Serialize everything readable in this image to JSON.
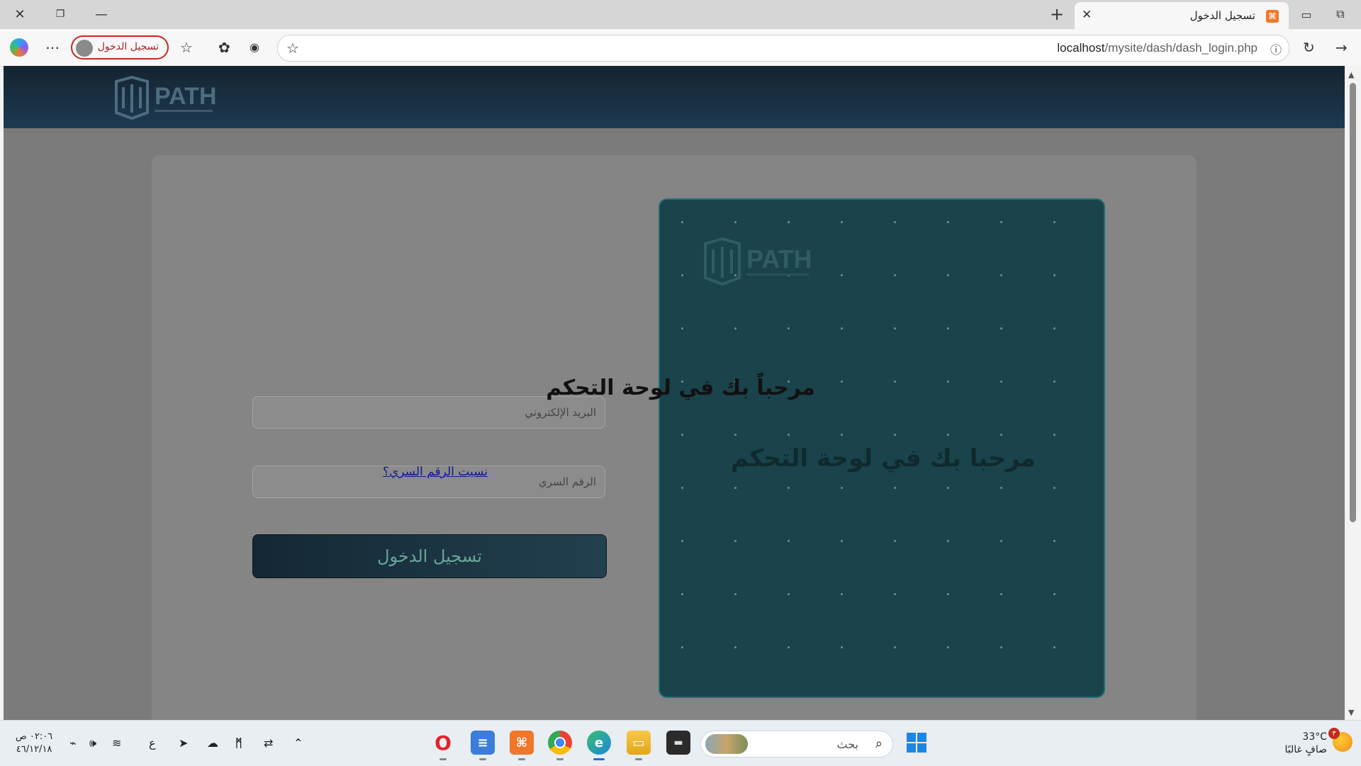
{
  "browser": {
    "tab": {
      "title": "تسجيل الدخول",
      "favicon": "xampp-icon",
      "favicon_color": "#f0762a"
    },
    "url": {
      "host": "localhost",
      "path": "/mysite/dash/dash_login.php"
    },
    "profile": {
      "label": "تسجيل الدخول"
    }
  },
  "page": {
    "logo_text": "PATH",
    "login_form": {
      "email_placeholder": "البريد الإلكتروني",
      "password_placeholder": "الرقم السري",
      "forgot_link": "نسيت الرقم السري؟",
      "submit_label": "تسجيل الدخول"
    },
    "welcome_panel": {
      "text": "مرحبا بك في لوحة التحكم"
    },
    "overlay_title": "مرحباً بك في لوحة التحكم"
  },
  "colors": {
    "header": "#1d3a52",
    "panel": "#1a434b",
    "panel_border": "#1e6f78",
    "button": "#142834",
    "link": "#0e1a8c"
  },
  "taskbar": {
    "search_label": "بحث",
    "weather": {
      "temp": "33°C",
      "condition": "صافٍ غالبًا",
      "badge": "٣"
    },
    "clock": {
      "time": "٠٢:٠٦ ص",
      "date": "٤٦/١٢/١٨"
    },
    "input_language": "ع",
    "apps": [
      "opera-icon",
      "notepad-icon",
      "xampp-icon",
      "chrome-icon",
      "edge-icon",
      "file-explorer-icon",
      "terminal-icon"
    ]
  }
}
